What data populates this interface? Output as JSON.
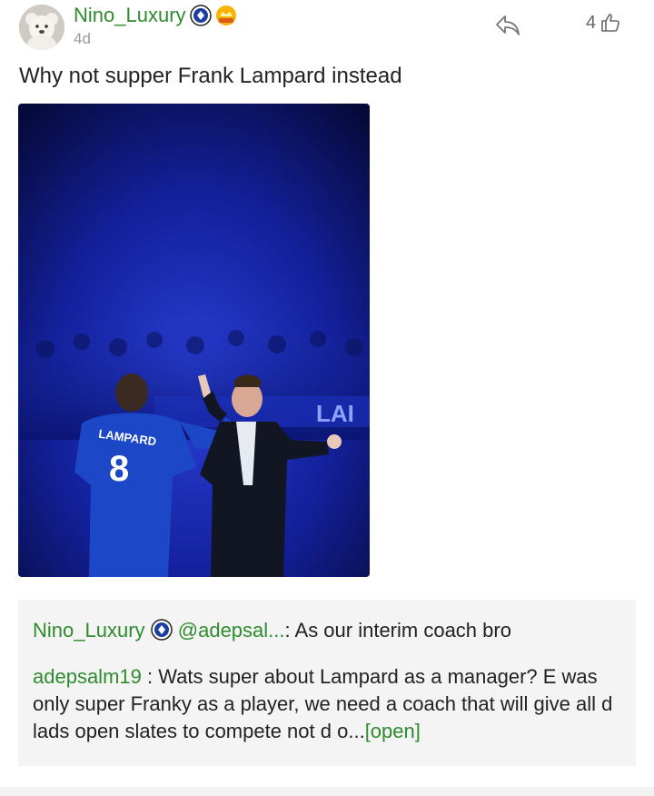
{
  "post": {
    "author": "Nino_Luxury",
    "time": "4d",
    "likes": "4",
    "text": "Why not supper Frank Lampard instead",
    "image": {
      "jersey_name": "LAMPARD",
      "jersey_number": "8",
      "banner_text": "LAI"
    },
    "icons": {
      "share": "share-icon",
      "like": "thumbs-up-icon",
      "club_badge": "club-crest-icon",
      "hot_badge": "hot-crown-icon"
    }
  },
  "comments": [
    {
      "user": "Nino_Luxury",
      "mention": "@adepsal...",
      "separator": ": ",
      "text": "As our interim coach bro"
    },
    {
      "user": "adepsalm19",
      "separator": " : ",
      "text": "Wats super about Lampard as a manager? E was only super Franky as a player, we need a coach that will give all d lads open slates to compete not d o...",
      "more": "[open]"
    }
  ],
  "colors": {
    "username": "#2e8b2e",
    "image_bg": "#0f1c8a"
  }
}
